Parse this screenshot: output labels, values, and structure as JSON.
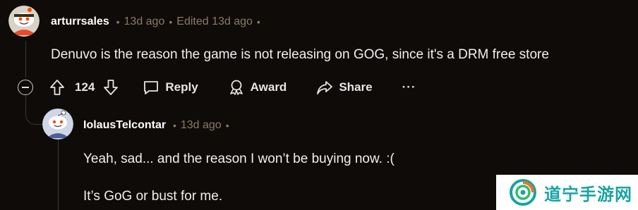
{
  "comment": {
    "username": "arturrsales",
    "time": "13d ago",
    "edited": "Edited 13d ago",
    "body": "Denuvo is the reason the game is not releasing on GOG, since it's a DRM free store",
    "vote_count": "124",
    "actions": {
      "reply": "Reply",
      "award": "Award",
      "share": "Share",
      "more": "···"
    }
  },
  "reply": {
    "username": "IolausTelcontar",
    "time": "13d ago",
    "body_line1": "Yeah, sad... and the reason I won’t be buying now. :(",
    "body_line2": "It’s GoG or bust for me."
  },
  "watermark": {
    "text": "道宁手游网"
  },
  "colors": {
    "background": "#0e0b08",
    "meta": "#8a7b66",
    "watermark_text": "#1aa3a3"
  }
}
